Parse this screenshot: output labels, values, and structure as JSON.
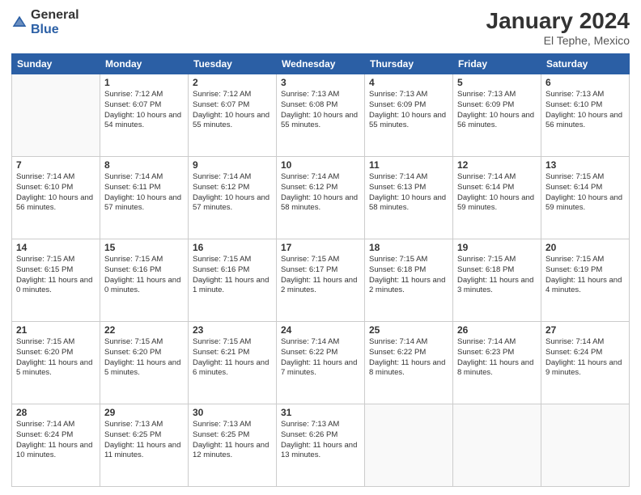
{
  "header": {
    "logo_general": "General",
    "logo_blue": "Blue",
    "main_title": "January 2024",
    "subtitle": "El Tephe, Mexico"
  },
  "days_of_week": [
    "Sunday",
    "Monday",
    "Tuesday",
    "Wednesday",
    "Thursday",
    "Friday",
    "Saturday"
  ],
  "weeks": [
    [
      {
        "day": "",
        "empty": true
      },
      {
        "day": "1",
        "sunrise": "Sunrise: 7:12 AM",
        "sunset": "Sunset: 6:07 PM",
        "daylight": "Daylight: 10 hours and 54 minutes."
      },
      {
        "day": "2",
        "sunrise": "Sunrise: 7:12 AM",
        "sunset": "Sunset: 6:07 PM",
        "daylight": "Daylight: 10 hours and 55 minutes."
      },
      {
        "day": "3",
        "sunrise": "Sunrise: 7:13 AM",
        "sunset": "Sunset: 6:08 PM",
        "daylight": "Daylight: 10 hours and 55 minutes."
      },
      {
        "day": "4",
        "sunrise": "Sunrise: 7:13 AM",
        "sunset": "Sunset: 6:09 PM",
        "daylight": "Daylight: 10 hours and 55 minutes."
      },
      {
        "day": "5",
        "sunrise": "Sunrise: 7:13 AM",
        "sunset": "Sunset: 6:09 PM",
        "daylight": "Daylight: 10 hours and 56 minutes."
      },
      {
        "day": "6",
        "sunrise": "Sunrise: 7:13 AM",
        "sunset": "Sunset: 6:10 PM",
        "daylight": "Daylight: 10 hours and 56 minutes."
      }
    ],
    [
      {
        "day": "7",
        "sunrise": "Sunrise: 7:14 AM",
        "sunset": "Sunset: 6:10 PM",
        "daylight": "Daylight: 10 hours and 56 minutes."
      },
      {
        "day": "8",
        "sunrise": "Sunrise: 7:14 AM",
        "sunset": "Sunset: 6:11 PM",
        "daylight": "Daylight: 10 hours and 57 minutes."
      },
      {
        "day": "9",
        "sunrise": "Sunrise: 7:14 AM",
        "sunset": "Sunset: 6:12 PM",
        "daylight": "Daylight: 10 hours and 57 minutes."
      },
      {
        "day": "10",
        "sunrise": "Sunrise: 7:14 AM",
        "sunset": "Sunset: 6:12 PM",
        "daylight": "Daylight: 10 hours and 58 minutes."
      },
      {
        "day": "11",
        "sunrise": "Sunrise: 7:14 AM",
        "sunset": "Sunset: 6:13 PM",
        "daylight": "Daylight: 10 hours and 58 minutes."
      },
      {
        "day": "12",
        "sunrise": "Sunrise: 7:14 AM",
        "sunset": "Sunset: 6:14 PM",
        "daylight": "Daylight: 10 hours and 59 minutes."
      },
      {
        "day": "13",
        "sunrise": "Sunrise: 7:15 AM",
        "sunset": "Sunset: 6:14 PM",
        "daylight": "Daylight: 10 hours and 59 minutes."
      }
    ],
    [
      {
        "day": "14",
        "sunrise": "Sunrise: 7:15 AM",
        "sunset": "Sunset: 6:15 PM",
        "daylight": "Daylight: 11 hours and 0 minutes."
      },
      {
        "day": "15",
        "sunrise": "Sunrise: 7:15 AM",
        "sunset": "Sunset: 6:16 PM",
        "daylight": "Daylight: 11 hours and 0 minutes."
      },
      {
        "day": "16",
        "sunrise": "Sunrise: 7:15 AM",
        "sunset": "Sunset: 6:16 PM",
        "daylight": "Daylight: 11 hours and 1 minute."
      },
      {
        "day": "17",
        "sunrise": "Sunrise: 7:15 AM",
        "sunset": "Sunset: 6:17 PM",
        "daylight": "Daylight: 11 hours and 2 minutes."
      },
      {
        "day": "18",
        "sunrise": "Sunrise: 7:15 AM",
        "sunset": "Sunset: 6:18 PM",
        "daylight": "Daylight: 11 hours and 2 minutes."
      },
      {
        "day": "19",
        "sunrise": "Sunrise: 7:15 AM",
        "sunset": "Sunset: 6:18 PM",
        "daylight": "Daylight: 11 hours and 3 minutes."
      },
      {
        "day": "20",
        "sunrise": "Sunrise: 7:15 AM",
        "sunset": "Sunset: 6:19 PM",
        "daylight": "Daylight: 11 hours and 4 minutes."
      }
    ],
    [
      {
        "day": "21",
        "sunrise": "Sunrise: 7:15 AM",
        "sunset": "Sunset: 6:20 PM",
        "daylight": "Daylight: 11 hours and 5 minutes."
      },
      {
        "day": "22",
        "sunrise": "Sunrise: 7:15 AM",
        "sunset": "Sunset: 6:20 PM",
        "daylight": "Daylight: 11 hours and 5 minutes."
      },
      {
        "day": "23",
        "sunrise": "Sunrise: 7:15 AM",
        "sunset": "Sunset: 6:21 PM",
        "daylight": "Daylight: 11 hours and 6 minutes."
      },
      {
        "day": "24",
        "sunrise": "Sunrise: 7:14 AM",
        "sunset": "Sunset: 6:22 PM",
        "daylight": "Daylight: 11 hours and 7 minutes."
      },
      {
        "day": "25",
        "sunrise": "Sunrise: 7:14 AM",
        "sunset": "Sunset: 6:22 PM",
        "daylight": "Daylight: 11 hours and 8 minutes."
      },
      {
        "day": "26",
        "sunrise": "Sunrise: 7:14 AM",
        "sunset": "Sunset: 6:23 PM",
        "daylight": "Daylight: 11 hours and 8 minutes."
      },
      {
        "day": "27",
        "sunrise": "Sunrise: 7:14 AM",
        "sunset": "Sunset: 6:24 PM",
        "daylight": "Daylight: 11 hours and 9 minutes."
      }
    ],
    [
      {
        "day": "28",
        "sunrise": "Sunrise: 7:14 AM",
        "sunset": "Sunset: 6:24 PM",
        "daylight": "Daylight: 11 hours and 10 minutes."
      },
      {
        "day": "29",
        "sunrise": "Sunrise: 7:13 AM",
        "sunset": "Sunset: 6:25 PM",
        "daylight": "Daylight: 11 hours and 11 minutes."
      },
      {
        "day": "30",
        "sunrise": "Sunrise: 7:13 AM",
        "sunset": "Sunset: 6:25 PM",
        "daylight": "Daylight: 11 hours and 12 minutes."
      },
      {
        "day": "31",
        "sunrise": "Sunrise: 7:13 AM",
        "sunset": "Sunset: 6:26 PM",
        "daylight": "Daylight: 11 hours and 13 minutes."
      },
      {
        "day": "",
        "empty": true
      },
      {
        "day": "",
        "empty": true
      },
      {
        "day": "",
        "empty": true
      }
    ]
  ]
}
